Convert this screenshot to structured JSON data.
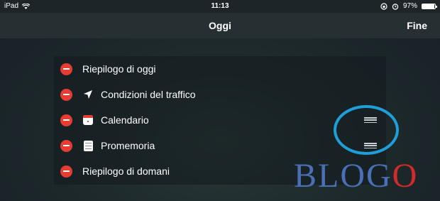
{
  "status_bar": {
    "device": "iPad",
    "time": "11:13",
    "battery": "97%",
    "battery_level": 0.97
  },
  "nav": {
    "title": "Oggi",
    "done_label": "Fine"
  },
  "rows": [
    {
      "label": "Riepilogo di oggi",
      "icon": null,
      "draggable": false
    },
    {
      "label": "Condizioni del traffico",
      "icon": "location-arrow-icon",
      "draggable": false
    },
    {
      "label": "Calendario",
      "icon": "calendar-icon",
      "draggable": true
    },
    {
      "label": "Promemoria",
      "icon": "reminders-icon",
      "draggable": true
    },
    {
      "label": "Riepilogo di domani",
      "icon": null,
      "draggable": false
    }
  ],
  "watermark": {
    "text_before": "BLOG",
    "text_accent": "O"
  },
  "colors": {
    "delete_red": "#e63c34",
    "highlight_circle": "#1f9fd8",
    "watermark_blue": "#4a6fb5",
    "watermark_red": "#d02a2a"
  }
}
